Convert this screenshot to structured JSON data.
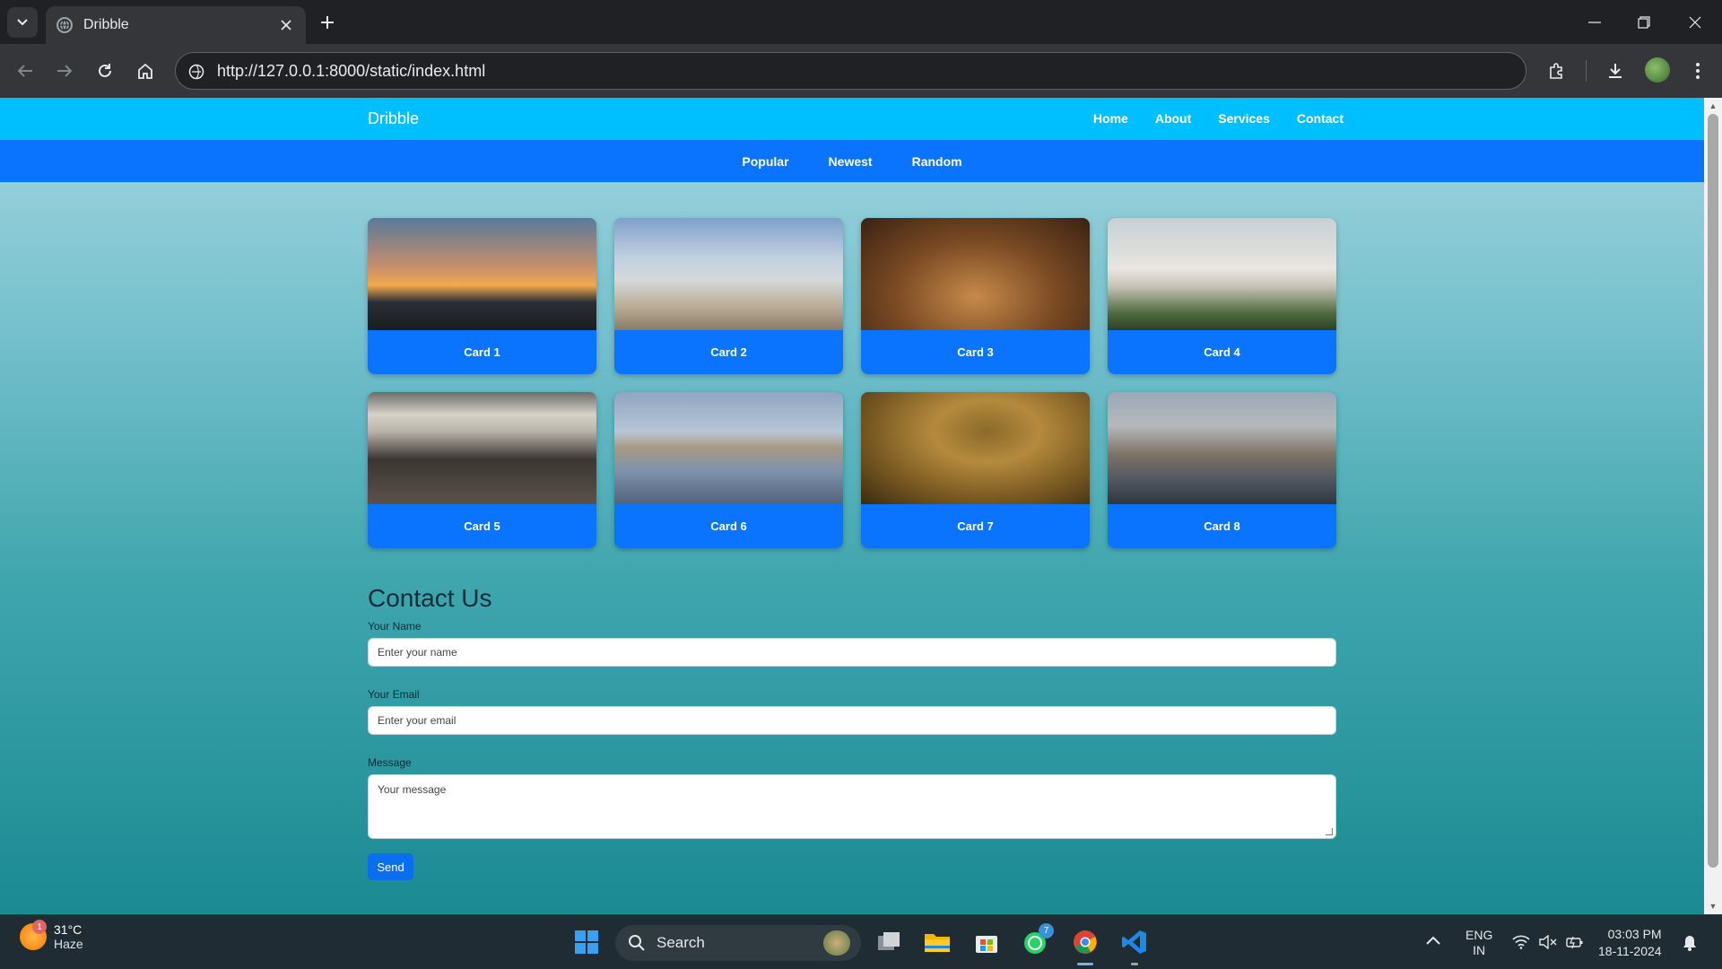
{
  "browser": {
    "tab_title": "Dribble",
    "url": "http://127.0.0.1:8000/static/index.html"
  },
  "site": {
    "brand": "Dribble",
    "nav_links": [
      "Home",
      "About",
      "Services",
      "Contact"
    ],
    "sub_nav": [
      "Popular",
      "Newest",
      "Random"
    ],
    "cards": [
      {
        "label": "Card 1"
      },
      {
        "label": "Card 2"
      },
      {
        "label": "Card 3"
      },
      {
        "label": "Card 4"
      },
      {
        "label": "Card 5"
      },
      {
        "label": "Card 6"
      },
      {
        "label": "Card 7"
      },
      {
        "label": "Card 8"
      }
    ],
    "contact": {
      "heading": "Contact Us",
      "name_label": "Your Name",
      "name_placeholder": "Enter your name",
      "email_label": "Your Email",
      "email_placeholder": "Enter your email",
      "message_label": "Message",
      "message_placeholder": "Your message",
      "send_label": "Send"
    },
    "colors": {
      "nav_primary": "#00bfff",
      "nav_secondary": "#0a74ff",
      "send_button": "#0a6ef0"
    }
  },
  "taskbar": {
    "weather_temp": "31°C",
    "weather_desc": "Haze",
    "weather_badge": "1",
    "search_label": "Search",
    "whatsapp_badge": "7",
    "lang_top": "ENG",
    "lang_bottom": "IN",
    "time": "03:03 PM",
    "date": "18-11-2024"
  }
}
